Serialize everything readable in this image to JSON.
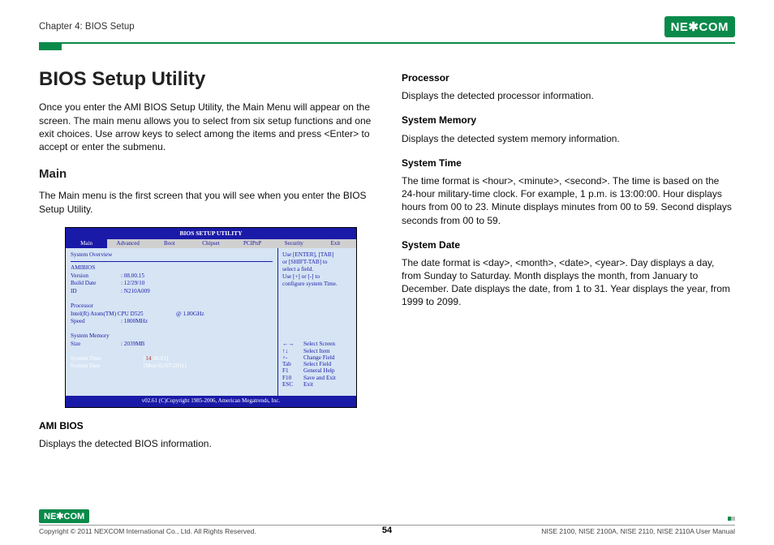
{
  "header": {
    "chapter": "Chapter 4: BIOS Setup",
    "brand": "NE✱COM"
  },
  "left": {
    "title": "BIOS Setup Utility",
    "intro": "Once you enter the AMI BIOS Setup Utility, the Main Menu will appear on the screen. The main menu allows you to select from six setup functions and one exit choices. Use arrow keys to select among the items and press <Enter> to accept or enter the submenu.",
    "main_h": "Main",
    "main_p": "The Main menu is the first screen that you will see when you enter the BIOS Setup Utility.",
    "amibios_h": "AMI BIOS",
    "amibios_p": "Displays the detected BIOS information."
  },
  "bios": {
    "title": "BIOS SETUP UTILITY",
    "tabs": [
      "Main",
      "Advanced",
      "Boot",
      "Chipset",
      "PCIPnP",
      "Security",
      "Exit"
    ],
    "overview": "System Overview",
    "amibios": "AMIBIOS",
    "version_l": "Version",
    "version_v": ": 08.00.15",
    "build_l": "Build Date",
    "build_v": ": 12/29/10",
    "id_l": "ID",
    "id_v": ": N210A009",
    "proc": "Processor",
    "proc_name": "Intel(R) Atom(TM) CPU D525",
    "proc_at": "@ 1.80GHz",
    "speed_l": "Speed",
    "speed_v": ": 1800MHz",
    "mem": "System Memory",
    "size_l": "Size",
    "size_v": ": 2039MB",
    "systime_l": "System Time",
    "systime_v": "[14:06:01]",
    "sysdate_l": "System Date",
    "sysdate_v": "[Mon 02/07/2011]",
    "help1": "Use [ENTER], [TAB]",
    "help2": "or [SHIFT-TAB] to",
    "help3": "select a field.",
    "help4": "Use [+] or [-] to",
    "help5": "configure system Time.",
    "nav": [
      {
        "k": "←→",
        "l": "Select Screen"
      },
      {
        "k": "↑↓",
        "l": "Select Item"
      },
      {
        "k": "+-",
        "l": "Change Field"
      },
      {
        "k": "Tab",
        "l": "Select Field"
      },
      {
        "k": "F1",
        "l": "General Help"
      },
      {
        "k": "F10",
        "l": "Save and Exit"
      },
      {
        "k": "ESC",
        "l": "Exit"
      }
    ],
    "footer": "v02.61 (C)Copyright 1985-2006, American Megatrends, Inc."
  },
  "right": {
    "proc_h": "Processor",
    "proc_p": "Displays the detected processor information.",
    "mem_h": "System Memory",
    "mem_p": "Displays the detected system memory information.",
    "time_h": "System Time",
    "time_p": "The time format is <hour>, <minute>, <second>. The time is based on the 24-hour military-time clock. For example, 1 p.m. is 13:00:00. Hour displays hours from 00 to 23. Minute displays minutes from 00 to 59. Second displays seconds from 00 to 59.",
    "date_h": "System Date",
    "date_p": "The date format is <day>, <month>, <date>, <year>. Day displays a day, from Sunday to Saturday. Month displays the month, from January to December. Date displays the date, from 1 to 31. Year displays the year, from 1999 to 2099."
  },
  "footer": {
    "brand": "NE✱COM",
    "copyright": "Copyright © 2011 NEXCOM International Co., Ltd. All Rights Reserved.",
    "page": "54",
    "models": "NISE 2100, NISE 2100A, NISE 2110, NISE 2110A User Manual"
  }
}
